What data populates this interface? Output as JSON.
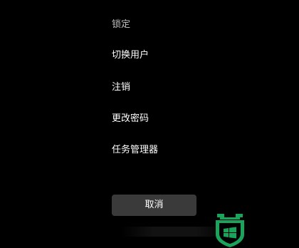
{
  "menu": {
    "items": [
      {
        "label": "锁定"
      },
      {
        "label": "切换用户"
      },
      {
        "label": "注销"
      },
      {
        "label": "更改密码"
      },
      {
        "label": "任务管理器"
      }
    ]
  },
  "cancel": {
    "label": "取消"
  },
  "colors": {
    "background": "#000000",
    "button_bg": "#3a3a3a",
    "text": "#ffffff",
    "logo_green": "#1aa35a"
  },
  "icons": {
    "watermark": "shield-windows-logo-icon"
  }
}
